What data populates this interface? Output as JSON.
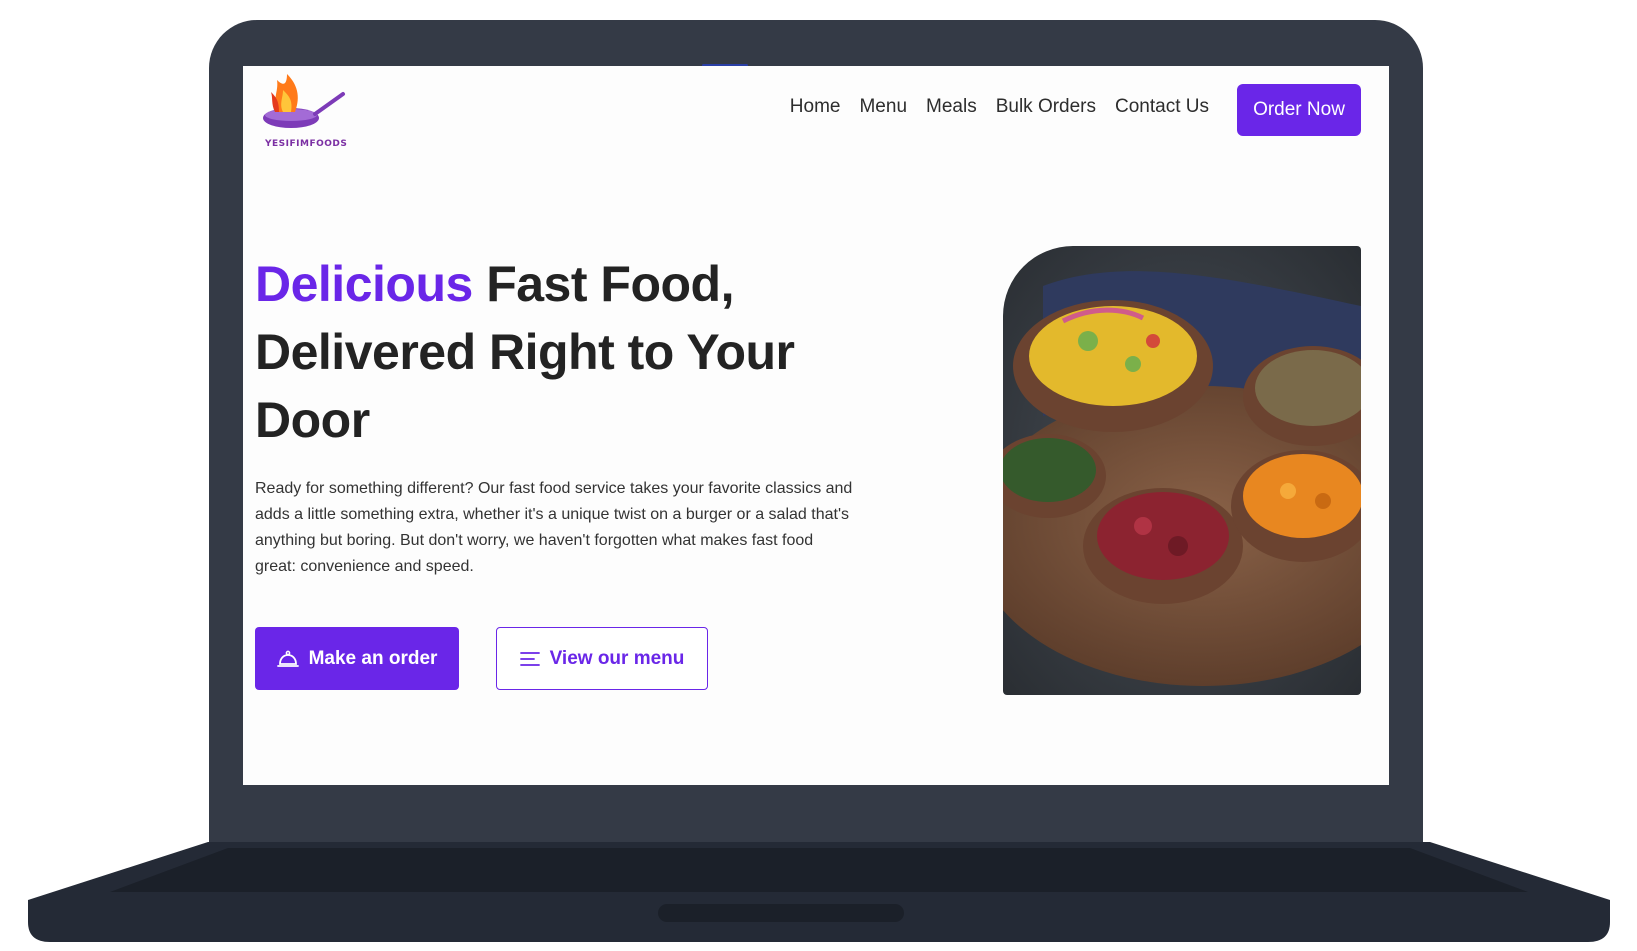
{
  "brand": {
    "logo_text": "YESIFIMFOODS",
    "accent_color": "#6a26e8"
  },
  "nav": {
    "items": [
      {
        "label": "Home"
      },
      {
        "label": "Menu"
      },
      {
        "label": "Meals"
      },
      {
        "label": "Bulk Orders"
      },
      {
        "label": "Contact Us"
      }
    ],
    "cta_label": "Order Now"
  },
  "hero": {
    "title_accent": "Delicious",
    "title_rest": "Fast Food, Delivered Right to Your Door",
    "description": "Ready for something different? Our fast food service takes your favorite classics and adds a little something extra, whether it's a unique twist on a burger or a salad that's anything but boring. But don't worry, we haven't forgotten what makes fast food great: convenience and speed.",
    "primary_button": {
      "label": "Make an order",
      "icon": "cloche-icon"
    },
    "secondary_button": {
      "label": "View our menu",
      "icon": "menu-lines-icon"
    },
    "image_subject": "bowls of african dishes"
  }
}
